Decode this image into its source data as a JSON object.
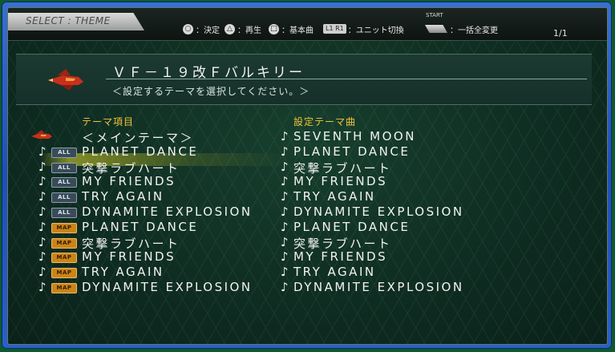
{
  "header": {
    "screen_tab": "SELECT : THEME",
    "controls": [
      {
        "icon": "○",
        "label": "：決定"
      },
      {
        "icon": "△",
        "label": "：再生"
      },
      {
        "icon": "□",
        "label": "：基本曲"
      },
      {
        "icon": "L1 R1",
        "label": "：ユニット切換"
      },
      {
        "icon": "START",
        "label": "：一括全変更"
      }
    ],
    "page": "1/1"
  },
  "unit": {
    "name": "ＶＦ－１９改Ｆバルキリー",
    "instruction": "＜設定するテーマを選択してください。＞"
  },
  "columns": {
    "item_header": "テーマ項目",
    "song_header": "設定テーマ曲"
  },
  "rows": [
    {
      "badge": "",
      "item": "＜メインテーマ＞",
      "song": "SEVENTH MOON",
      "icon": "ship-icon"
    },
    {
      "badge": "ALL",
      "item": "PLANET DANCE",
      "song": "PLANET DANCE"
    },
    {
      "badge": "ALL",
      "item": "突撃ラブハート",
      "song": "突撃ラブハート"
    },
    {
      "badge": "ALL",
      "item": "MY FRIENDS",
      "song": "MY FRIENDS"
    },
    {
      "badge": "ALL",
      "item": "TRY AGAIN",
      "song": "TRY AGAIN"
    },
    {
      "badge": "ALL",
      "item": "DYNAMITE EXPLOSION",
      "song": "DYNAMITE EXPLOSION"
    },
    {
      "badge": "MAP",
      "item": "PLANET DANCE",
      "song": "PLANET DANCE"
    },
    {
      "badge": "MAP",
      "item": "突撃ラブハート",
      "song": "突撃ラブハート"
    },
    {
      "badge": "MAP",
      "item": "MY FRIENDS",
      "song": "MY FRIENDS"
    },
    {
      "badge": "MAP",
      "item": "TRY AGAIN",
      "song": "TRY AGAIN"
    },
    {
      "badge": "MAP",
      "item": "DYNAMITE EXPLOSION",
      "song": "DYNAMITE EXPLOSION"
    }
  ],
  "note_glyph": "♪",
  "colors": {
    "frame": "#2b5fc8",
    "screen_bg": "#0f2d22",
    "column_header": "#f0c43a",
    "selection_glow": "#e6dc28",
    "map_badge": "#c9851a"
  }
}
